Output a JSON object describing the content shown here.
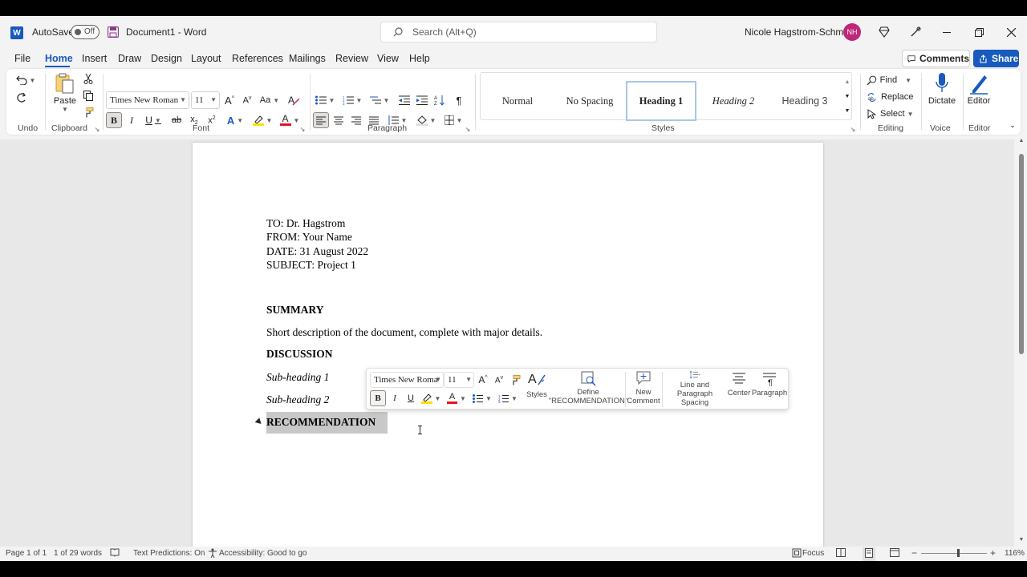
{
  "titlebar": {
    "autosave_label": "AutoSave",
    "autosave_state": "Off",
    "doc_title": "Document1 - Word",
    "search_placeholder": "Search (Alt+Q)",
    "user_name": "Nicole Hagstrom-Schmidt",
    "user_initials": "NH",
    "avatar_color": "#c0267a"
  },
  "menu": {
    "items": [
      "File",
      "Home",
      "Insert",
      "Draw",
      "Design",
      "Layout",
      "References",
      "Mailings",
      "Review",
      "View",
      "Help"
    ],
    "active": "Home",
    "comments_label": "Comments",
    "share_label": "Share",
    "accent": "#185abd"
  },
  "ribbon": {
    "undo_label": "Undo",
    "clipboard_label": "Clipboard",
    "paste_label": "Paste",
    "font_label": "Font",
    "font_name": "Times New Roman",
    "font_size": "11",
    "paragraph_label": "Paragraph",
    "styles_label": "Styles",
    "styles": [
      "Normal",
      "No Spacing",
      "Heading 1",
      "Heading 2",
      "Heading 3"
    ],
    "selected_style": "Heading 1",
    "editing_label": "Editing",
    "find_label": "Find",
    "replace_label": "Replace",
    "select_label": "Select",
    "voice_label": "Voice",
    "dictate_label": "Dictate",
    "editor_group_label": "Editor",
    "editor_label": "Editor"
  },
  "document": {
    "to": "TO: Dr. Hagstrom",
    "from": "FROM: Your Name",
    "date": "DATE: 31 August 2022",
    "subject": "SUBJECT: Project 1",
    "summary_heading": "SUMMARY",
    "summary_text": "Short description of the document, complete with major details.",
    "discussion_heading": "DISCUSSION",
    "sub1": "Sub-heading 1",
    "sub2": "Sub-heading 2",
    "recommendation_heading": "RECOMMENDATION"
  },
  "mini_toolbar": {
    "font_name": "Times New Roma",
    "font_size": "11",
    "styles_label": "Styles",
    "define_label_1": "Define",
    "define_label_2": "\"RECOMMENDATION\"",
    "new_label_1": "New",
    "new_label_2": "Comment",
    "spacing_label_1": "Line and",
    "spacing_label_2": "Paragraph Spacing",
    "center_label": "Center",
    "paragraph_label": "Paragraph"
  },
  "status": {
    "page": "Page 1 of 1",
    "words": "1 of 29 words",
    "text_predictions": "Text Predictions: On",
    "accessibility": "Accessibility: Good to go",
    "focus": "Focus",
    "zoom": "116%",
    "zoom_fraction": 0.55
  }
}
